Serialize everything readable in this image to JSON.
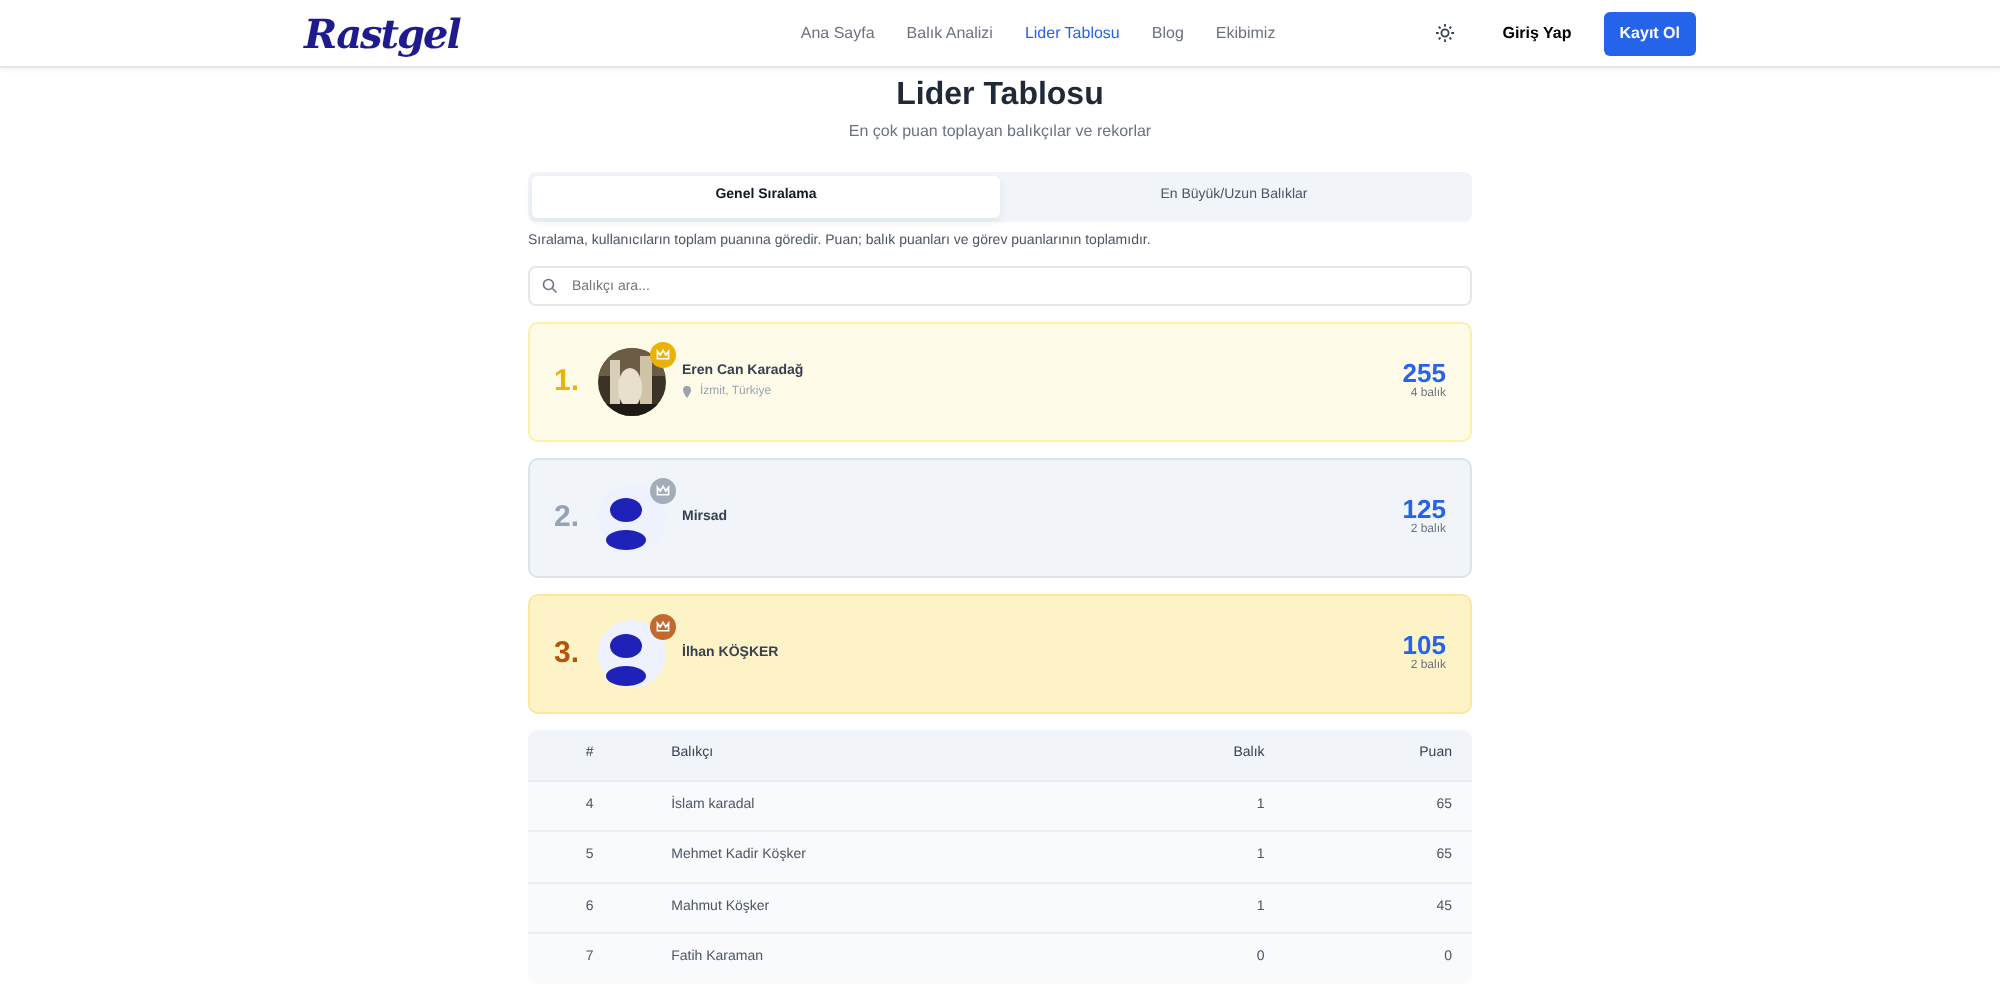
{
  "navbar": {
    "logo": "Rastgel",
    "links": [
      {
        "label": "Ana Sayfa",
        "selected": false
      },
      {
        "label": "Balık Analizi",
        "selected": false
      },
      {
        "label": "Lider Tablosu",
        "selected": true
      },
      {
        "label": "Blog",
        "selected": false
      },
      {
        "label": "Ekibimiz",
        "selected": false
      }
    ],
    "login": "Giriş Yap",
    "signup": "Kayıt Ol"
  },
  "title": "Lider Tablosu",
  "subtitle": "En çok puan toplayan balıkçılar ve rekorlar",
  "tabs": [
    {
      "label": "Genel Sıralama",
      "selected": true
    },
    {
      "label": "En Büyük/Uzun Balıklar",
      "selected": false
    }
  ],
  "note": "Sıralama, kullanıcıların toplam puanına göredir. Puan; balık puanları ve görev puanlarının toplamıdır.",
  "search": {
    "placeholder": "Balıkçı ara..."
  },
  "podium": [
    {
      "rank": "1.",
      "kind": "gold",
      "name": "Eren Can Karadağ",
      "location": "İzmit, Türkiye",
      "points": "255",
      "fish": "4 balık"
    },
    {
      "rank": "2.",
      "kind": "silver",
      "avatar": {
        "kind": "default"
      },
      "name": "Mirsad",
      "points": "125",
      "fish": "2 balık"
    },
    {
      "rank": "3.",
      "kind": "bronze",
      "avatar": {
        "kind": "default"
      },
      "name": "İlhan KÖŞKER",
      "points": "105",
      "fish": "2 balık"
    }
  ],
  "table": {
    "columns": [
      "#",
      "Balıkçı",
      "Balık",
      "Puan"
    ],
    "rows": [
      [
        "4",
        "İslam karadal",
        "1",
        "65"
      ],
      [
        "5",
        "Mehmet Kadir Köşker",
        "1",
        "65"
      ],
      [
        "6",
        "Mahmut Köşker",
        "1",
        "45"
      ],
      [
        "7",
        "Fatih Karaman",
        "0",
        "0"
      ]
    ]
  }
}
